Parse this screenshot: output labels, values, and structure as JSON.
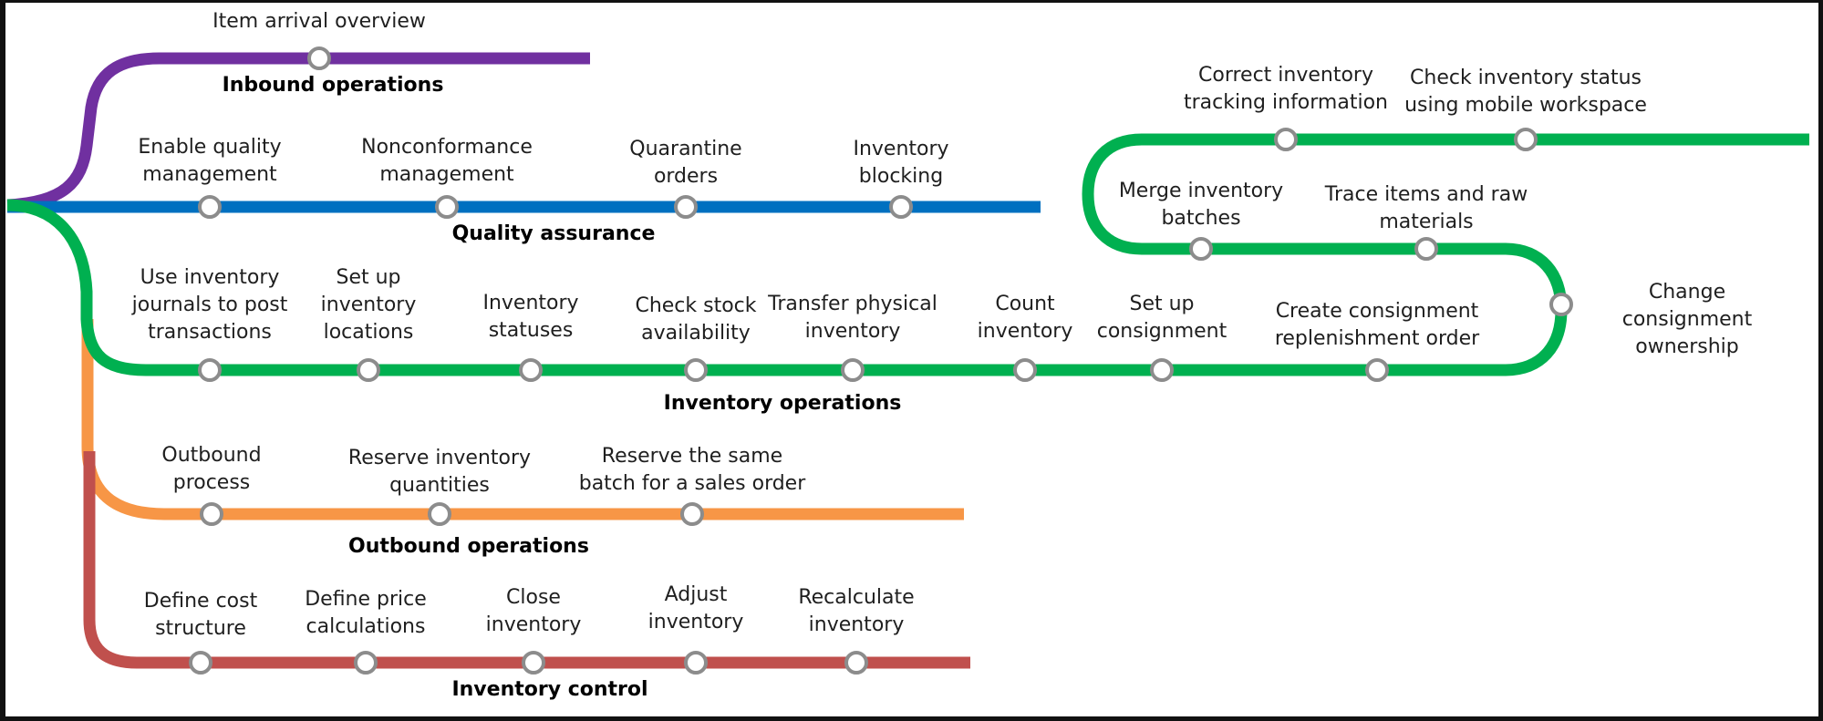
{
  "diagram": {
    "type": "subway-map",
    "lines": [
      {
        "id": "inbound",
        "title": "Inbound operations",
        "color": "#7030a0",
        "stations": [
          "Item arrival overview"
        ]
      },
      {
        "id": "quality",
        "title": "Quality assurance",
        "color": "#0070c0",
        "stations": [
          "Enable quality\nmanagement",
          "Nonconformance\nmanagement",
          "Quarantine\norders",
          "Inventory\nblocking"
        ]
      },
      {
        "id": "inventory",
        "title": "Inventory operations",
        "color": "#00b050",
        "stations": [
          "Use inventory\njournals to post\ntransactions",
          "Set up\ninventory\nlocations",
          "Inventory\nstatuses",
          "Check stock\navailability",
          "Transfer physical\ninventory",
          "Count\ninventory",
          "Set up\nconsignment",
          "Create consignment\nreplenishment order",
          "Change consignment\nownership",
          "Trace items and raw\nmaterials",
          "Merge inventory\nbatches",
          "Correct inventory\ntracking information",
          "Check inventory status\nusing mobile workspace"
        ]
      },
      {
        "id": "outbound",
        "title": "Outbound operations",
        "color": "#f79646",
        "stations": [
          "Outbound\nprocess",
          "Reserve inventory\nquantities",
          "Reserve the same\nbatch for a sales order"
        ]
      },
      {
        "id": "control",
        "title": "Inventory control",
        "color": "#c0504d",
        "stations": [
          "Define cost\nstructure",
          "Define price\ncalculations",
          "Close\ninventory",
          "Adjust\ninventory",
          "Recalculate\ninventory"
        ]
      }
    ],
    "station_style": {
      "fill": "#ffffff",
      "stroke": "#8c8c8c"
    }
  }
}
